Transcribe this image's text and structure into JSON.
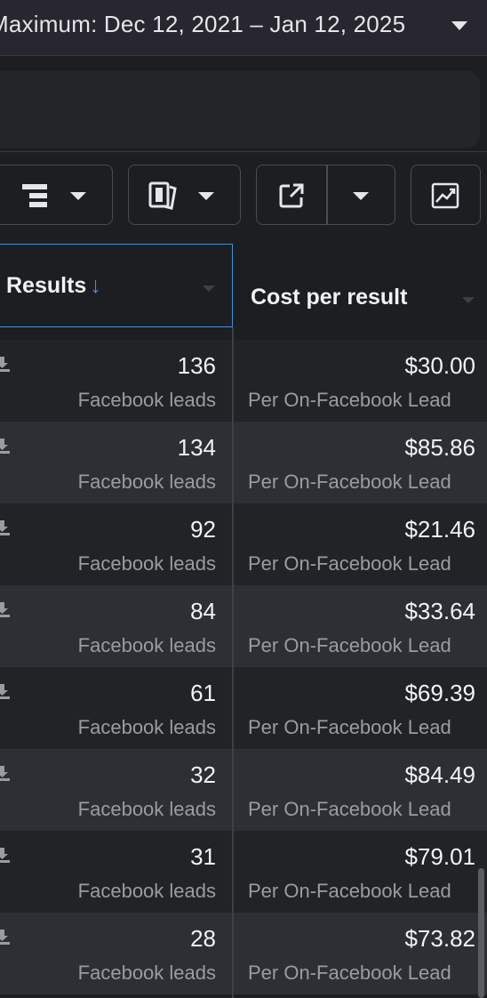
{
  "date_range": {
    "label": "Maximum: Dec 12, 2021 – Jan 12, 2025"
  },
  "toolbar": {
    "buttons": [
      {
        "icon": "breakdown-icon"
      },
      {
        "icon": "columns-icon"
      },
      {
        "icon": "export-icon"
      },
      {
        "icon": "chart-icon"
      }
    ]
  },
  "table": {
    "columns": [
      {
        "label": "Results",
        "sort": "descending"
      },
      {
        "label": "Cost per result"
      }
    ],
    "rows": [
      {
        "results": "136",
        "result_type": "Facebook leads",
        "cost": "$30.00",
        "cost_type": "Per On-Facebook Lead"
      },
      {
        "results": "134",
        "result_type": "Facebook leads",
        "cost": "$85.86",
        "cost_type": "Per On-Facebook Lead"
      },
      {
        "results": "92",
        "result_type": "Facebook leads",
        "cost": "$21.46",
        "cost_type": "Per On-Facebook Lead"
      },
      {
        "results": "84",
        "result_type": "Facebook leads",
        "cost": "$33.64",
        "cost_type": "Per On-Facebook Lead"
      },
      {
        "results": "61",
        "result_type": "Facebook leads",
        "cost": "$69.39",
        "cost_type": "Per On-Facebook Lead"
      },
      {
        "results": "32",
        "result_type": "Facebook leads",
        "cost": "$84.49",
        "cost_type": "Per On-Facebook Lead"
      },
      {
        "results": "31",
        "result_type": "Facebook leads",
        "cost": "$79.01",
        "cost_type": "Per On-Facebook Lead"
      },
      {
        "results": "28",
        "result_type": "Facebook leads",
        "cost": "$73.82",
        "cost_type": "Per On-Facebook Lead"
      }
    ]
  }
}
